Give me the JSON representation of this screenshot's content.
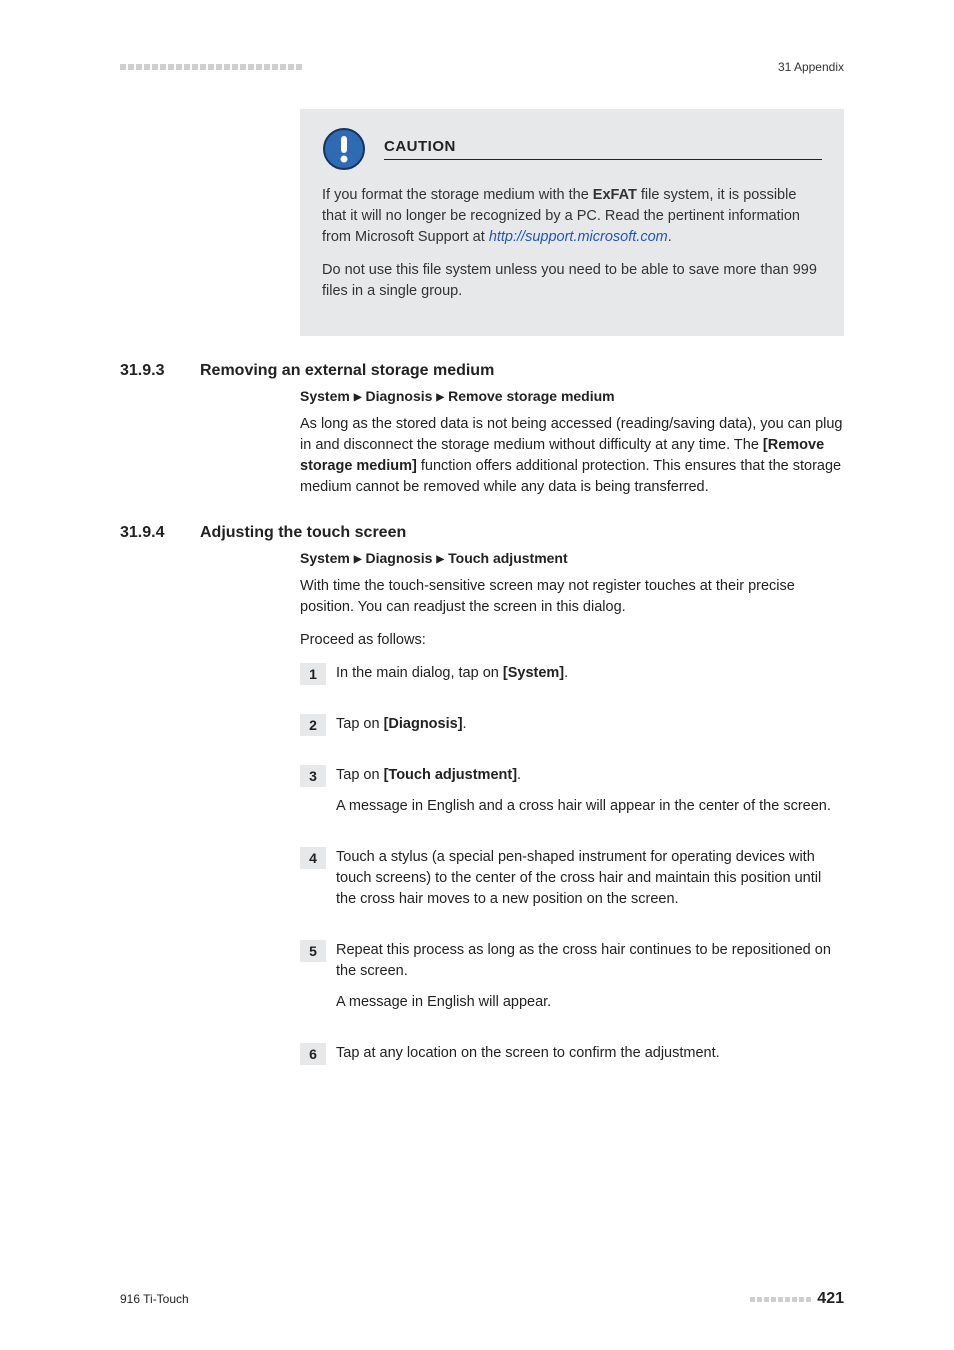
{
  "header": {
    "chapter": "31 Appendix"
  },
  "caution": {
    "title": "CAUTION",
    "p1_pre": "If you format the storage medium with the ",
    "p1_bold": "ExFAT",
    "p1_mid": " file system, it is possible that it will no longer be recognized by a PC. Read the pertinent information from Microsoft Support at ",
    "link": "http://support.microsoft.com",
    "p1_end": ".",
    "p2": "Do not use this file system unless you need to be able to save more than 999 files in a single group."
  },
  "s1": {
    "num": "31.9.3",
    "title": "Removing an external storage medium",
    "crumb1": "System",
    "crumb2": "Diagnosis",
    "crumb3": "Remove storage medium",
    "para_pre": "As long as the stored data is not being accessed (reading/saving data), you can plug in and disconnect the storage medium without difficulty at any time. The ",
    "para_bold": "[Remove storage medium]",
    "para_post": " function offers additional protection. This ensures that the storage medium cannot be removed while any data is being transferred."
  },
  "s2": {
    "num": "31.9.4",
    "title": "Adjusting the touch screen",
    "crumb1": "System",
    "crumb2": "Diagnosis",
    "crumb3": "Touch adjustment",
    "para1": "With time the touch-sensitive screen may not register touches at their precise position. You can readjust the screen in this dialog.",
    "para2": "Proceed as follows:"
  },
  "steps": {
    "s1_pre": "In the main dialog, tap on ",
    "s1_bold": "[System]",
    "s1_end": ".",
    "s2_pre": "Tap on ",
    "s2_bold": "[Diagnosis]",
    "s2_end": ".",
    "s3_pre": "Tap on ",
    "s3_bold": "[Touch adjustment]",
    "s3_end": ".",
    "s3_p2": "A message in English and a cross hair will appear in the center of the screen.",
    "s4": "Touch a stylus (a special pen-shaped instrument for operating devices with touch screens) to the center of the cross hair and maintain this position until the cross hair moves to a new position on the screen.",
    "s5_p1": "Repeat this process as long as the cross hair continues to be repositioned on the screen.",
    "s5_p2": "A message in English will appear.",
    "s6": "Tap at any location on the screen to confirm the adjustment."
  },
  "footer": {
    "left": "916 Ti-Touch",
    "page": "421"
  },
  "nums": {
    "n1": "1",
    "n2": "2",
    "n3": "3",
    "n4": "4",
    "n5": "5",
    "n6": "6"
  }
}
